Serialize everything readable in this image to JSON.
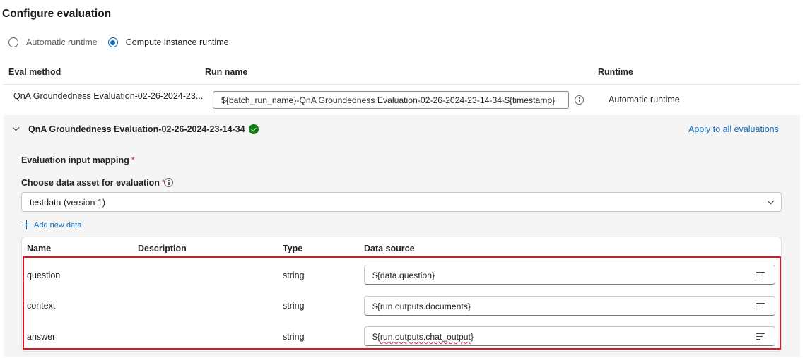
{
  "page_title": "Configure evaluation",
  "runtime_options": [
    {
      "label": "Automatic runtime",
      "selected": false
    },
    {
      "label": "Compute instance runtime",
      "selected": true
    }
  ],
  "top_table": {
    "headers": {
      "eval_method": "Eval method",
      "run_name": "Run name",
      "runtime": "Runtime"
    },
    "row": {
      "eval_method": "QnA Groundedness Evaluation-02-26-2024-23...",
      "run_name": "${batch_run_name}-QnA Groundedness Evaluation-02-26-2024-23-14-34-${timestamp}",
      "runtime": "Automatic runtime"
    }
  },
  "section": {
    "title": "QnA Groundedness Evaluation-02-26-2024-23-14-34",
    "status": "success",
    "apply_all_label": "Apply to all evaluations",
    "input_mapping_label": "Evaluation input mapping",
    "data_asset_label": "Choose data asset for evaluation",
    "required_mark": "*",
    "selected_data_asset": "testdata (version 1)",
    "add_new_data_label": "Add new data"
  },
  "mapping_table": {
    "headers": {
      "name": "Name",
      "description": "Description",
      "type": "Type",
      "data_source": "Data source"
    },
    "rows": [
      {
        "name": "question",
        "description": "",
        "type": "string",
        "data_source": "${data.question}"
      },
      {
        "name": "context",
        "description": "",
        "type": "string",
        "data_source": "${run.outputs.documents}"
      },
      {
        "name": "answer",
        "description": "",
        "type": "string",
        "data_source_prefix": "${",
        "data_source_squiggle": "run.outputs.chat_output",
        "data_source_suffix": "}"
      }
    ]
  },
  "colors": {
    "accent": "#0f6cbd",
    "success": "#107c10",
    "highlight": "#e81123",
    "required": "#c4314b"
  },
  "icons": [
    "radio-icon",
    "info-icon",
    "chevron-down-icon",
    "check-circle-icon",
    "plus-icon",
    "edit-mapping-icon"
  ]
}
